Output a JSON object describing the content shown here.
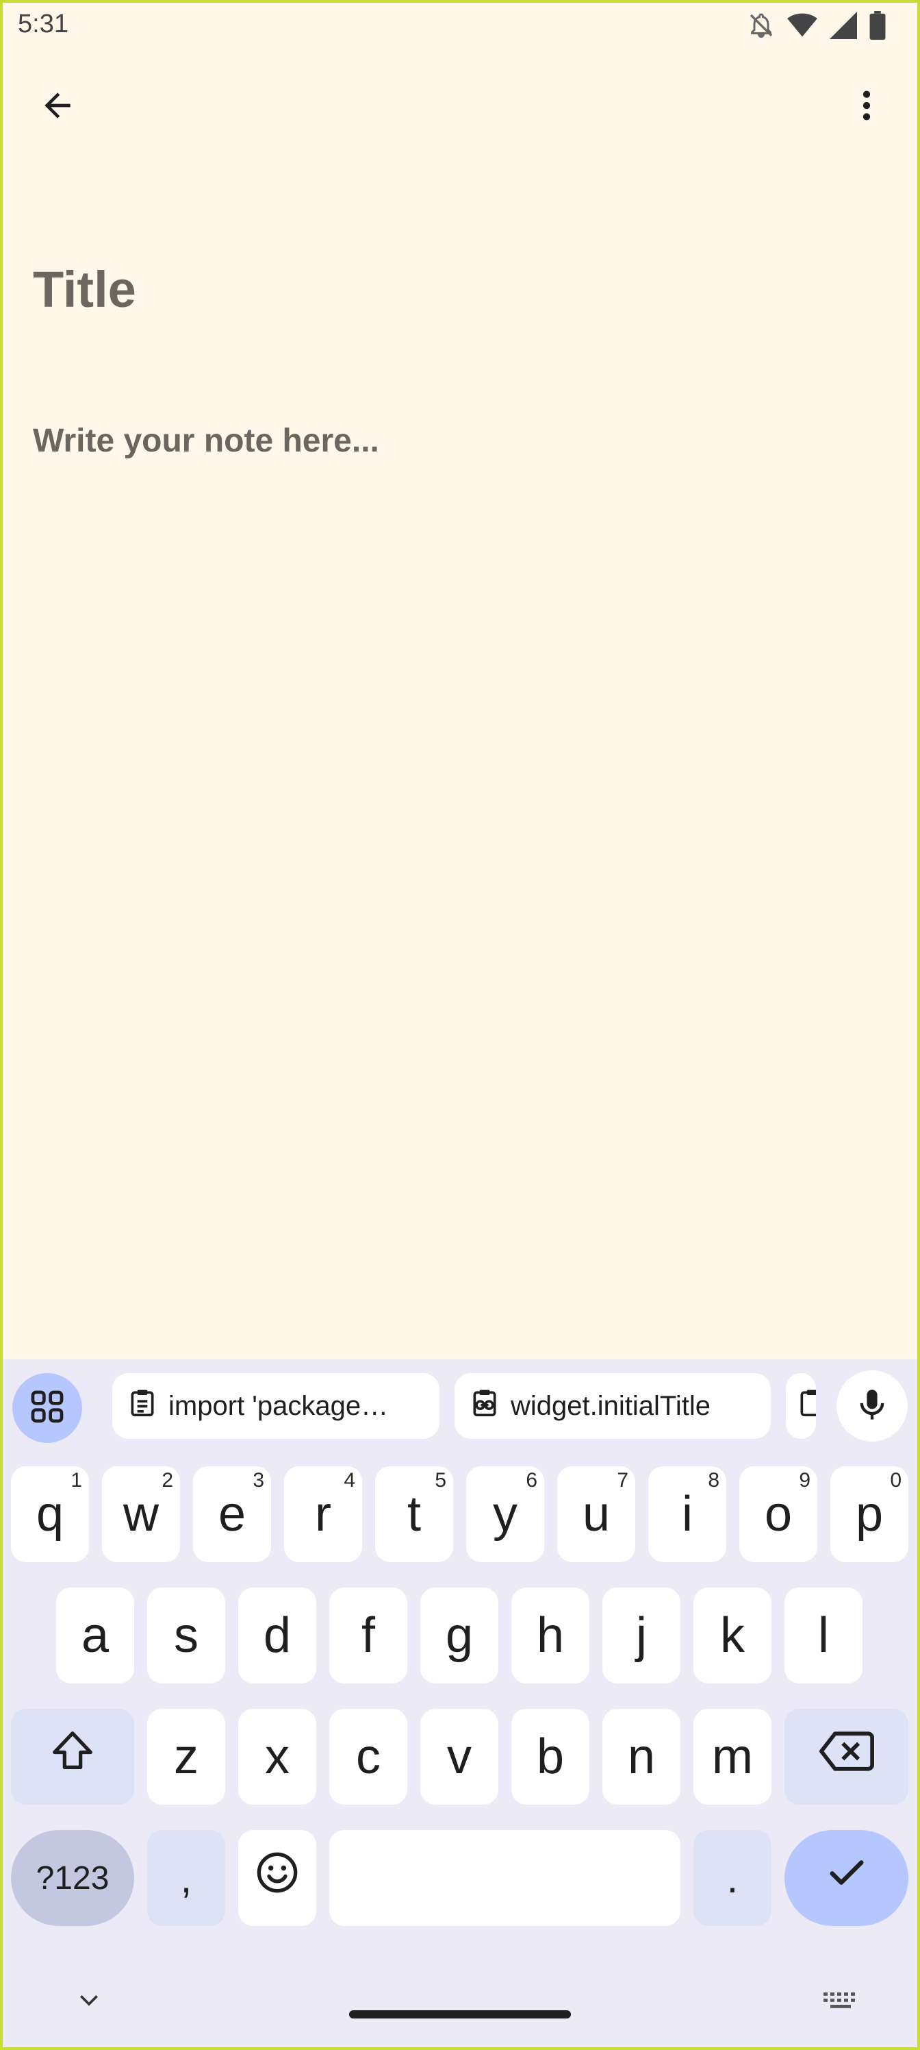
{
  "status_bar": {
    "time": "5:31",
    "icons": [
      "bell-muted-icon",
      "wifi-icon",
      "signal-icon",
      "battery-icon"
    ]
  },
  "app_bar": {
    "back_icon": "arrow-left-icon",
    "more_icon": "more-vertical-icon"
  },
  "editor": {
    "title_placeholder": "Title",
    "body_placeholder": "Write your note here..."
  },
  "keyboard": {
    "suggestions": [
      {
        "icon": "clipboard-icon",
        "text": "import 'package…"
      },
      {
        "icon": "clipboard-link-icon",
        "text": "widget.initialTitle"
      },
      {
        "icon": "clipboard-icon",
        "text": ""
      }
    ],
    "row1": [
      {
        "key": "q",
        "hint": "1"
      },
      {
        "key": "w",
        "hint": "2"
      },
      {
        "key": "e",
        "hint": "3"
      },
      {
        "key": "r",
        "hint": "4"
      },
      {
        "key": "t",
        "hint": "5"
      },
      {
        "key": "y",
        "hint": "6"
      },
      {
        "key": "u",
        "hint": "7"
      },
      {
        "key": "i",
        "hint": "8"
      },
      {
        "key": "o",
        "hint": "9"
      },
      {
        "key": "p",
        "hint": "0"
      }
    ],
    "row2": [
      "a",
      "s",
      "d",
      "f",
      "g",
      "h",
      "j",
      "k",
      "l"
    ],
    "row3": [
      "z",
      "x",
      "c",
      "v",
      "b",
      "n",
      "m"
    ],
    "symbols_label": "?123",
    "comma": ",",
    "period": ".",
    "accent_color": "#b6c7ff"
  }
}
